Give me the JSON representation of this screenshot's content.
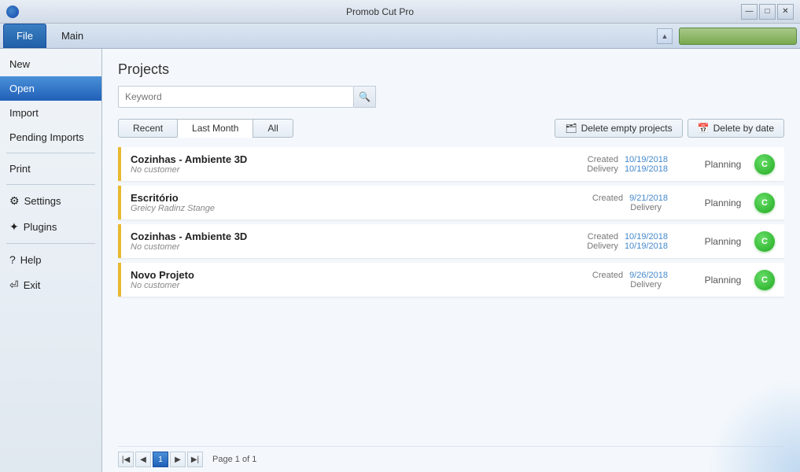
{
  "window": {
    "title": "Promob Cut Pro",
    "min_btn": "—",
    "max_btn": "□",
    "close_btn": "✕"
  },
  "menu": {
    "file_label": "File",
    "main_label": "Main"
  },
  "sidebar": {
    "new_label": "New",
    "open_label": "Open",
    "import_label": "Import",
    "pending_label": "Pending Imports",
    "print_label": "Print",
    "settings_label": "Settings",
    "plugins_label": "Plugins",
    "help_label": "Help",
    "exit_label": "Exit"
  },
  "content": {
    "title": "Projects",
    "search_placeholder": "Keyword",
    "tabs": [
      {
        "label": "Recent",
        "active": false
      },
      {
        "label": "Last Month",
        "active": true
      },
      {
        "label": "All",
        "active": false
      }
    ],
    "delete_empty_btn": "Delete empty projects",
    "delete_date_btn": "Delete by date",
    "projects": [
      {
        "name": "Cozinhas - Ambiente 3D",
        "customer": "No customer",
        "created_label": "Created",
        "created_date": "10/19/2018",
        "delivery_label": "Delivery",
        "delivery_date": "10/19/2018",
        "status": "Planning",
        "icon_letter": "C"
      },
      {
        "name": "Escritório",
        "customer": "Greicy Radinz Stange",
        "created_label": "Created",
        "created_date": "9/21/2018",
        "delivery_label": "Delivery",
        "delivery_date": "",
        "status": "Planning",
        "icon_letter": "C"
      },
      {
        "name": "Cozinhas - Ambiente 3D",
        "customer": "No customer",
        "created_label": "Created",
        "created_date": "10/19/2018",
        "delivery_label": "Delivery",
        "delivery_date": "10/19/2018",
        "status": "Planning",
        "icon_letter": "C"
      },
      {
        "name": "Novo Projeto",
        "customer": "No customer",
        "created_label": "Created",
        "created_date": "9/26/2018",
        "delivery_label": "Delivery",
        "delivery_date": "",
        "status": "Planning",
        "icon_letter": "C"
      }
    ],
    "pagination": {
      "page_label": "Page",
      "current_page": "1",
      "of_label": "of",
      "total_pages": "1"
    }
  }
}
